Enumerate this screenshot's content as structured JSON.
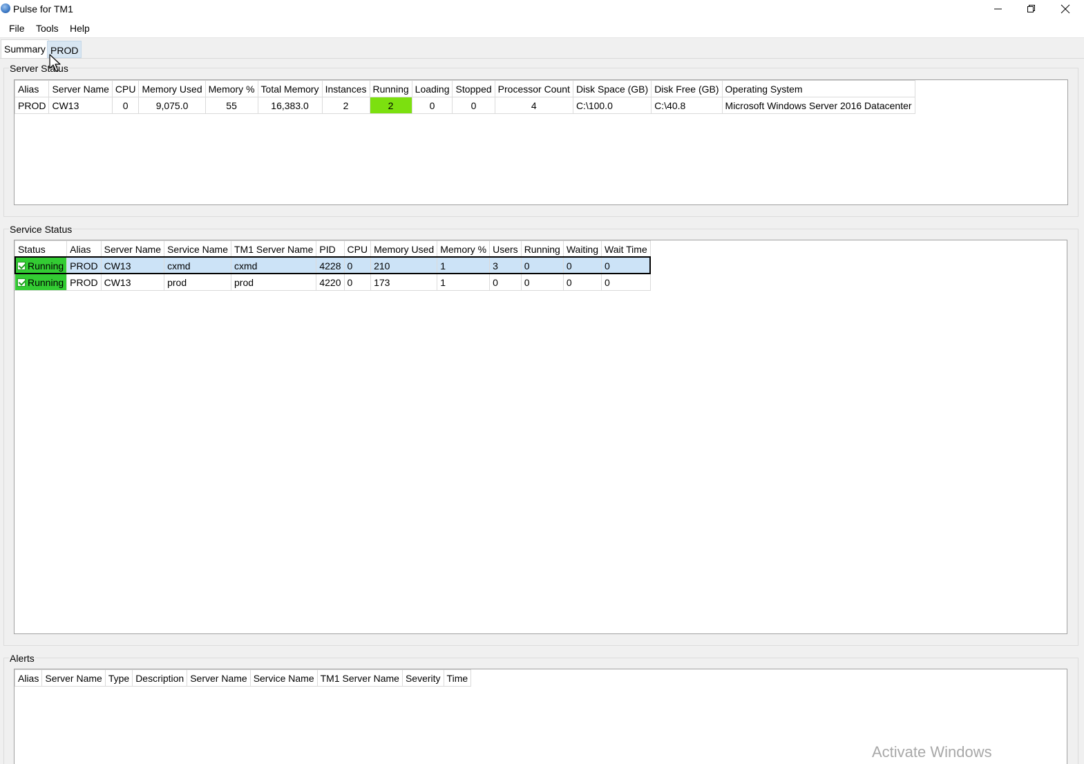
{
  "window": {
    "title": "Pulse for TM1"
  },
  "menu": [
    "File",
    "Tools",
    "Help"
  ],
  "tabs": [
    "Summary",
    "PROD"
  ],
  "server_status": {
    "label": "Server Status",
    "columns": [
      "Alias",
      "Server Name",
      "CPU",
      "Memory Used",
      "Memory %",
      "Total Memory",
      "Instances",
      "Running",
      "Loading",
      "Stopped",
      "Processor Count",
      "Disk Space (GB)",
      "Disk Free (GB)",
      "Operating System"
    ],
    "rows": [
      [
        "PROD",
        "CW13",
        "0",
        "9,075.0",
        "55",
        "16,383.0",
        "2",
        "2",
        "0",
        "0",
        "4",
        "C:\\100.0",
        "C:\\40.8",
        "Microsoft Windows Server 2016 Datacenter"
      ]
    ]
  },
  "service_status": {
    "label": "Service Status",
    "columns": [
      "Status",
      "Alias",
      "Server Name",
      "Service Name",
      "TM1 Server Name",
      "PID",
      "CPU",
      "Memory Used",
      "Memory %",
      "Users",
      "Running",
      "Waiting",
      "Wait Time"
    ],
    "rows": [
      [
        "Running",
        "PROD",
        "CW13",
        "cxmd",
        "cxmd",
        "4228",
        "0",
        "210",
        "1",
        "3",
        "0",
        "0",
        "0"
      ],
      [
        "Running",
        "PROD",
        "CW13",
        "prod",
        "prod",
        "4220",
        "0",
        "173",
        "1",
        "0",
        "0",
        "0",
        "0"
      ]
    ],
    "selected_row": 0
  },
  "alerts": {
    "label": "Alerts",
    "columns": [
      "Alias",
      "Server Name",
      "Type",
      "Description",
      "Server Name",
      "Service Name",
      "TM1 Server Name",
      "Severity",
      "Time"
    ]
  },
  "watermark": "Activate Windows",
  "colors": {
    "running_highlight": "#7ce00f",
    "status_running": "#33cc33",
    "selection": "#cce3f7"
  }
}
